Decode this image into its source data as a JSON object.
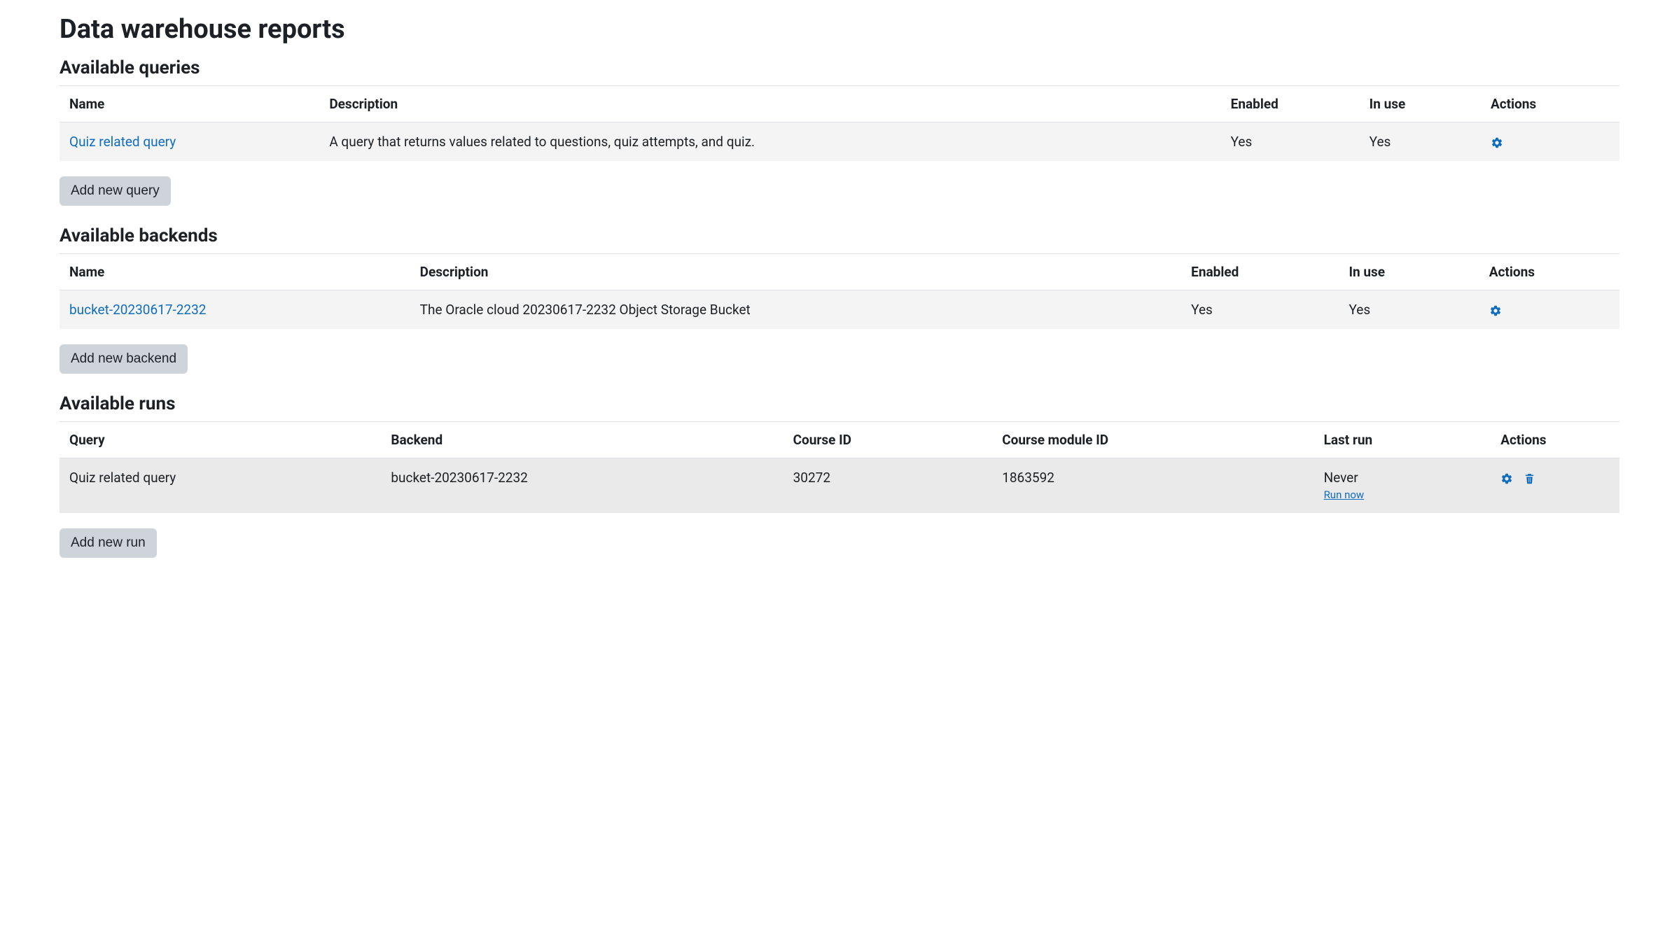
{
  "page": {
    "title": "Data warehouse reports"
  },
  "queries": {
    "heading": "Available queries",
    "columns": {
      "name": "Name",
      "description": "Description",
      "enabled": "Enabled",
      "in_use": "In use",
      "actions": "Actions"
    },
    "rows": [
      {
        "name": "Quiz related query",
        "description": "A query that returns values related to questions, quiz attempts, and quiz.",
        "enabled": "Yes",
        "in_use": "Yes"
      }
    ],
    "add_label": "Add new query"
  },
  "backends": {
    "heading": "Available backends",
    "columns": {
      "name": "Name",
      "description": "Description",
      "enabled": "Enabled",
      "in_use": "In use",
      "actions": "Actions"
    },
    "rows": [
      {
        "name": "bucket-20230617-2232",
        "description": "The Oracle cloud 20230617-2232 Object Storage Bucket",
        "enabled": "Yes",
        "in_use": "Yes"
      }
    ],
    "add_label": "Add new backend"
  },
  "runs": {
    "heading": "Available runs",
    "columns": {
      "query": "Query",
      "backend": "Backend",
      "course_id": "Course ID",
      "course_module_id": "Course module ID",
      "last_run": "Last run",
      "actions": "Actions"
    },
    "rows": [
      {
        "query": "Quiz related query",
        "backend": "bucket-20230617-2232",
        "course_id": "30272",
        "course_module_id": "1863592",
        "last_run": "Never",
        "run_now": "Run now"
      }
    ],
    "add_label": "Add new run"
  }
}
